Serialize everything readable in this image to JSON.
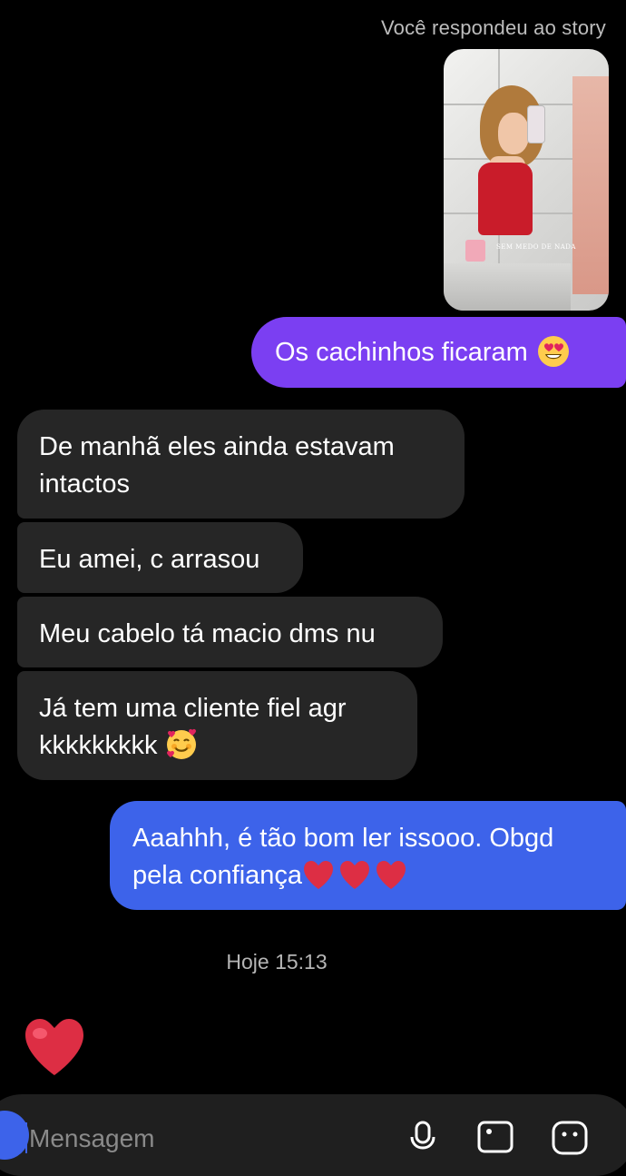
{
  "story": {
    "reply_note": "Você respondeu ao story",
    "watermark": "SEM MEDO DE NADA"
  },
  "messages": [
    {
      "side": "out",
      "text": "Os cachinhos ficaram",
      "emoji": "heart-eyes-emoji"
    },
    {
      "side": "in",
      "lines": [
        "De manhã eles ainda estavam",
        "intactos"
      ]
    },
    {
      "side": "in",
      "text": "Eu amei, c arrasou"
    },
    {
      "side": "in",
      "text": "Meu cabelo tá macio dms nu"
    },
    {
      "side": "in",
      "lines": [
        "Já tem uma cliente fiel agr",
        "kkkkkkkkk"
      ],
      "emoji": "smiling-face-with-hearts-emoji"
    },
    {
      "side": "out",
      "lines": [
        "Aaahhh, é tão bom ler issooo. Obgd",
        "pela confiança"
      ],
      "emoji": "red-heart-emoji x3"
    }
  ],
  "timestamp": "Hoje 15:13",
  "reaction": "red-heart-emoji",
  "composer": {
    "placeholder": "Mensagem",
    "icons": [
      "camera-icon",
      "microphone-icon",
      "gallery-icon",
      "sticker-icon"
    ]
  },
  "colors": {
    "outgoing_purple": "#7b3ff2",
    "outgoing_blue": "#3d63ea",
    "incoming": "#262626",
    "background": "#000000"
  }
}
